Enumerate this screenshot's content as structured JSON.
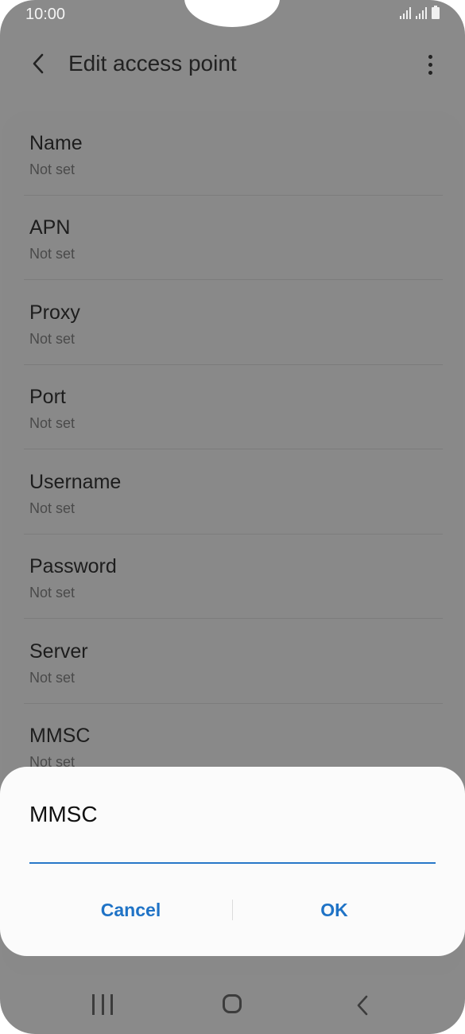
{
  "status_bar": {
    "time": "10:00"
  },
  "header": {
    "title": "Edit access point",
    "back_icon": "chevron-left-icon",
    "more_icon": "more-vertical-icon"
  },
  "settings": [
    {
      "label": "Name",
      "value": "Not set"
    },
    {
      "label": "APN",
      "value": "Not set"
    },
    {
      "label": "Proxy",
      "value": "Not set"
    },
    {
      "label": "Port",
      "value": "Not set"
    },
    {
      "label": "Username",
      "value": "Not set"
    },
    {
      "label": "Password",
      "value": "Not set"
    },
    {
      "label": "Server",
      "value": "Not set"
    },
    {
      "label": "MMSC",
      "value": "Not set"
    }
  ],
  "dialog": {
    "title": "MMSC",
    "input_value": "",
    "cancel_label": "Cancel",
    "ok_label": "OK"
  },
  "nav_bar": {
    "recents_icon": "recents-icon",
    "home_icon": "home-icon",
    "back_icon": "back-icon"
  },
  "colors": {
    "accent": "#1f73c6",
    "scrim": "#8a8a8a",
    "dialog_bg": "#fbfbfb"
  }
}
